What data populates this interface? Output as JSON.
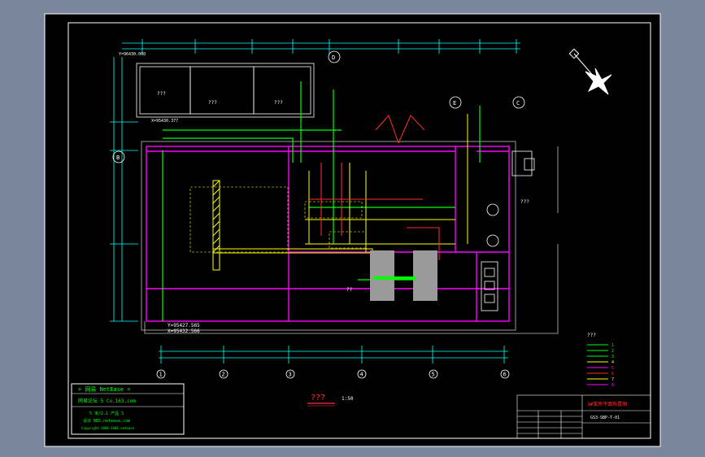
{
  "colors": {
    "background": "#7a869c",
    "sheet": "#000000",
    "frame": "#ffffff",
    "dimension": "#00ffff",
    "wall": "#ff00ff",
    "pipe_green": "#00ff00",
    "pipe_yellow": "#ffff00",
    "pipe_red": "#ff3030",
    "equipment": "#9a9a9a"
  },
  "drawing": {
    "scale_label": "???",
    "scale_ratio": "1:50",
    "top_labels": [
      "???",
      "???",
      "???"
    ],
    "elev_labels": [
      "Y=95427.565",
      "X=95432.566",
      "X=95430.377",
      "Y=96430.000"
    ],
    "grid_labels": [
      "1",
      "2",
      "3",
      "4",
      "5",
      "6"
    ],
    "callout_bottom": "??",
    "room_label": "???",
    "equip_label": "??",
    "circle_labels": [
      "D",
      "E",
      "C",
      "B"
    ]
  },
  "legend": {
    "title": "???",
    "items": [
      {
        "code": "1",
        "color": "#00ff00"
      },
      {
        "code": "2",
        "color": "#00ff00"
      },
      {
        "code": "3",
        "color": "#00ff00"
      },
      {
        "code": "4",
        "color": "#ffff00"
      },
      {
        "code": "5",
        "color": "#ff00ff"
      },
      {
        "code": "6",
        "color": "#ff3030"
      },
      {
        "code": "7",
        "color": "#ffff00"
      },
      {
        "code": "8",
        "color": "#ff00ff"
      }
    ]
  },
  "logo_box": {
    "line1": "=  网易  NetEase  =",
    "line2": "网易论坛 5    Co.163.com",
    "line3": "5 米/2.1 产品 S",
    "line4": "设计 BBS.netease.com",
    "line5": "Copyright 2004-2006 netease"
  },
  "title_block": {
    "project": "3#泵房平面布置图",
    "drawing_no": "GS3-SBP-T-01"
  }
}
